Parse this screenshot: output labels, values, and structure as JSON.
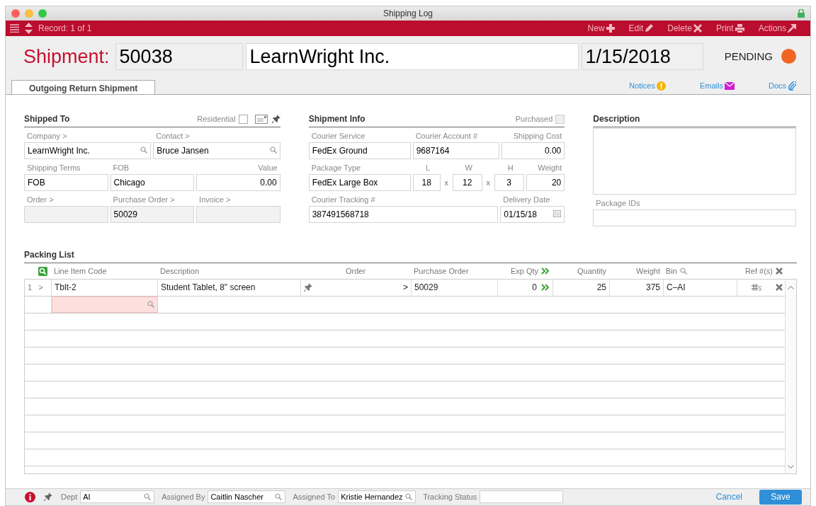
{
  "window": {
    "title": "Shipping Log"
  },
  "toolbar": {
    "record": "Record: 1 of 1",
    "actions": [
      {
        "label": "New"
      },
      {
        "label": "Edit"
      },
      {
        "label": "Delete"
      },
      {
        "label": "Print"
      },
      {
        "label": "Actions"
      }
    ]
  },
  "header": {
    "label": "Shipment:",
    "number": "50038",
    "company": "LearnWright Inc.",
    "date": "1/15/2018",
    "status": "PENDING"
  },
  "tabs": [
    {
      "label": "Outgoing Return Shipment",
      "selected": true
    }
  ],
  "links": [
    {
      "label": "Notices"
    },
    {
      "label": "Emails"
    },
    {
      "label": "Docs"
    }
  ],
  "shipped_to": {
    "title": "Shipped To",
    "checkbox": {
      "label": "Residential",
      "checked": false,
      "disabled": false
    },
    "fields": [
      {
        "label": "Company >",
        "value": "LearnWright Inc.",
        "kind": "search"
      },
      {
        "label": "Contact >",
        "value": "Bruce Jansen",
        "kind": "search"
      },
      {
        "label": "Shipping Terms",
        "value": "FOB",
        "kind": "text"
      },
      {
        "label": "FOB",
        "value": "Chicago",
        "kind": "text"
      },
      {
        "label": "Value",
        "value": "0.00",
        "kind": "number"
      },
      {
        "label": "Order >",
        "kind": "readonly"
      },
      {
        "label": "Purchase Order >",
        "value": "50029",
        "kind": "readonly"
      },
      {
        "label": "Invoice >",
        "kind": "readonly"
      }
    ]
  },
  "shipment_info": {
    "title": "Shipment Info",
    "checkbox": {
      "label": "Purchased",
      "checked": false,
      "disabled": true
    },
    "fields": [
      {
        "label": "Courier Service",
        "value": "FedEx Ground",
        "kind": "text"
      },
      {
        "label": "Courier Account #",
        "value": "9687164",
        "kind": "text"
      },
      {
        "label": "Shipping Cost",
        "value": "0.00",
        "kind": "number"
      },
      {
        "label": "Package Type",
        "value": "FedEx Large Box",
        "kind": "text"
      },
      {
        "label": "L",
        "value": "18",
        "kind": "dimension"
      },
      {
        "text": "x",
        "kind": "times"
      },
      {
        "label": "W",
        "value": "12",
        "kind": "dimension"
      },
      {
        "text": "x",
        "kind": "times"
      },
      {
        "label": "H",
        "value": "3",
        "kind": "dimension"
      },
      {
        "label": "Weight",
        "value": "20",
        "kind": "number"
      },
      {
        "label": "Courier Tracking #",
        "value": "387491568718",
        "kind": "text"
      },
      {
        "label": "Delivery Date",
        "value": "01/15/18",
        "kind": "date"
      }
    ]
  },
  "description": {
    "title": "Description",
    "package_ids_label": "Package IDs"
  },
  "packing_list": {
    "title": "Packing List",
    "columns": [
      {
        "label": "Line Item Code",
        "kind": "text"
      },
      {
        "label": "Description",
        "kind": "text"
      },
      {
        "label": "Order",
        "kind": "center"
      },
      {
        "label": "Purchase Order",
        "kind": "text"
      },
      {
        "label": "Exp Qty",
        "kind": "number"
      },
      {
        "label": "Quantity",
        "kind": "number"
      },
      {
        "label": "Weight",
        "kind": "number"
      },
      {
        "label": "Bin",
        "kind": "text"
      },
      {
        "label": "Ref #(s)",
        "kind": "number"
      }
    ],
    "rows": [
      {
        "number": "1",
        "expander": ">",
        "cells": [
          "Tblt-2",
          "Student Tablet, 8\" screen",
          ">",
          "50029",
          "0",
          "25",
          "375",
          "C–AI"
        ]
      }
    ]
  },
  "footer": {
    "fields": [
      {
        "label": "Dept",
        "value": "AI",
        "kind": "search"
      },
      {
        "label": "Assigned By",
        "value": "Caitlin Nascher",
        "kind": "search"
      },
      {
        "label": "Assigned To",
        "value": "Kristie Hernandez",
        "kind": "search"
      },
      {
        "label": "Tracking Status",
        "kind": "text"
      }
    ],
    "cancel": "Cancel",
    "save": "Save"
  }
}
